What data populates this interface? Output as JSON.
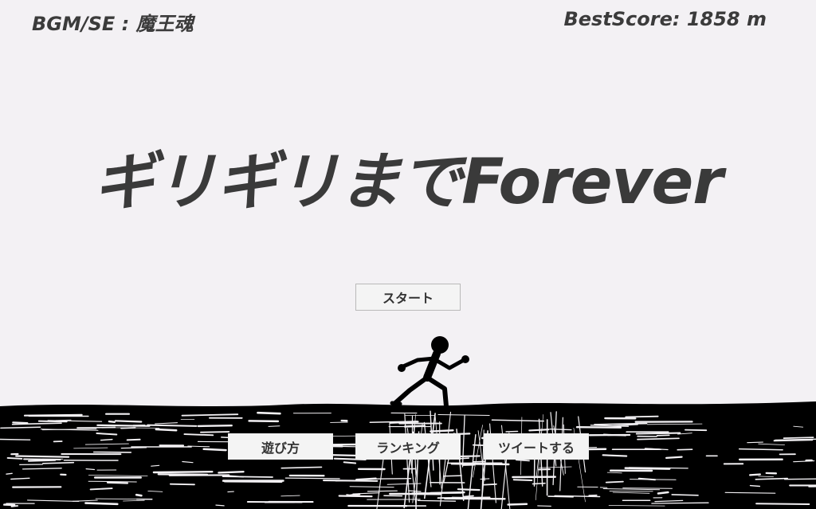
{
  "hud": {
    "credit": "BGM/SE : 魔王魂",
    "best_score": "BestScore: 1858 m"
  },
  "title": "ギリギリまでForever",
  "buttons": {
    "start": "スタート",
    "how_to_play": "遊び方",
    "ranking": "ランキング",
    "tweet": "ツイートする"
  },
  "colors": {
    "background": "#f3f1f4",
    "ground": "#000000",
    "text": "#3a3a3a"
  },
  "icons": {
    "runner": "stick-figure-runner"
  }
}
